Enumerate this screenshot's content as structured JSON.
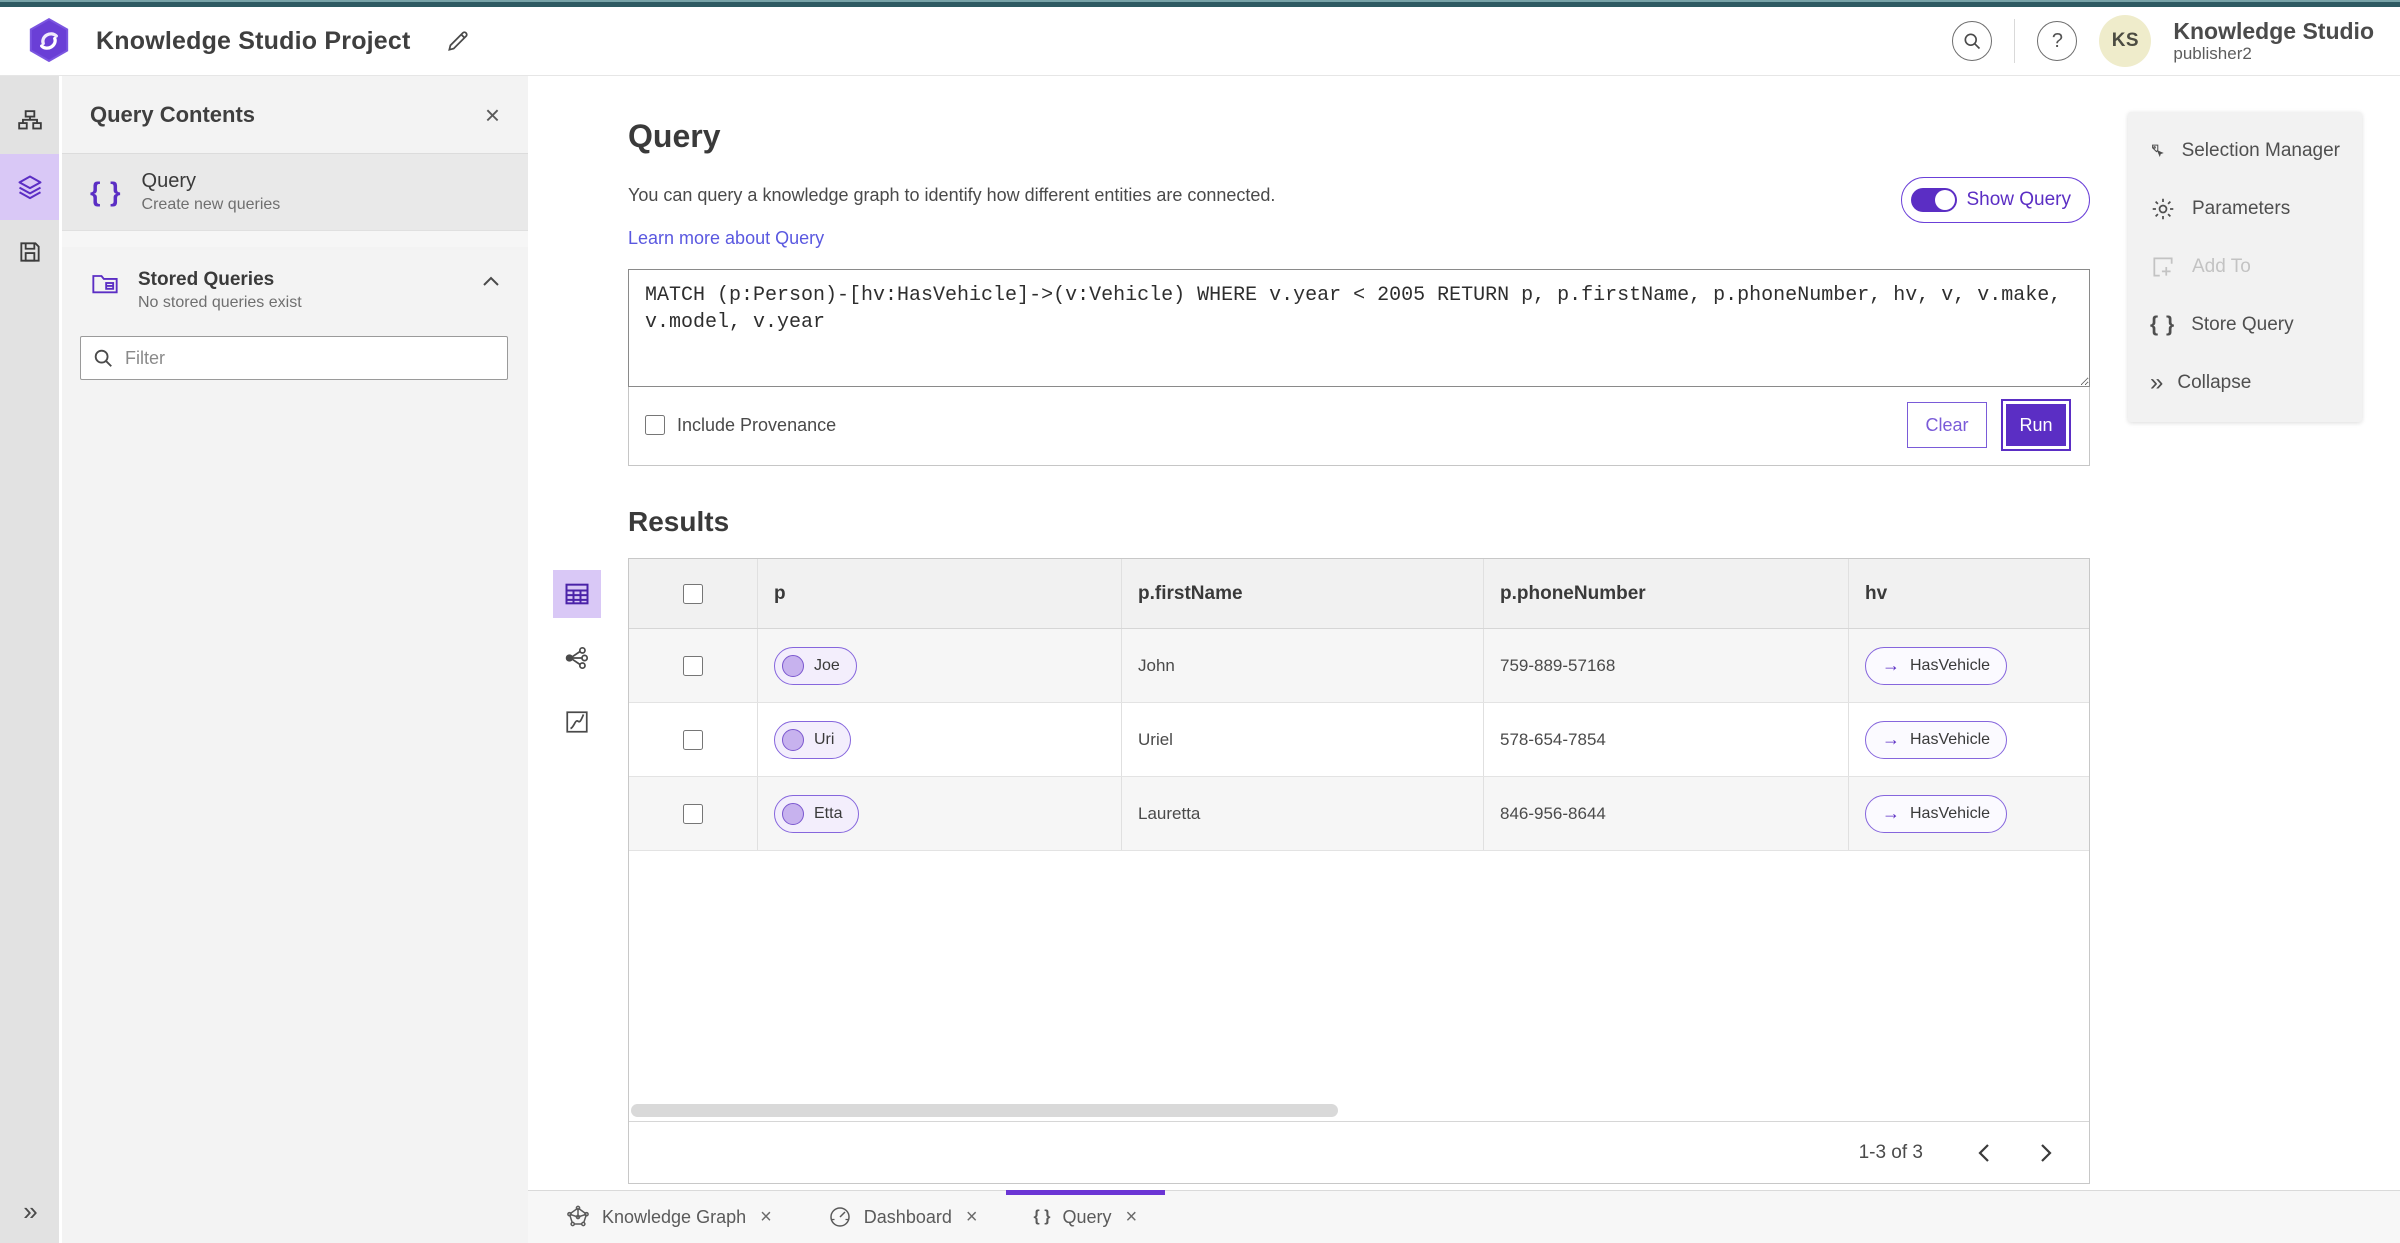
{
  "header": {
    "title": "Knowledge Studio Project",
    "user_initials": "KS",
    "user_name": "Knowledge Studio",
    "user_role": "publisher2"
  },
  "glyphs": {
    "close": "×",
    "braces": "{ }",
    "help": "?",
    "collapse": "»",
    "expand": "»",
    "arrow": "→"
  },
  "sidebar": {
    "title": "Query Contents",
    "query_item": {
      "label": "Query",
      "description": "Create new queries"
    },
    "stored": {
      "label": "Stored Queries",
      "description": "No stored queries exist"
    },
    "filter_placeholder": "Filter"
  },
  "query": {
    "heading": "Query",
    "description": "You can query a knowledge graph to identify how different entities are connected.",
    "link": "Learn more about Query",
    "show_query_label": "Show Query",
    "text": "MATCH (p:Person)-[hv:HasVehicle]->(v:Vehicle) WHERE v.year < 2005 RETURN p, p.firstName, p.phoneNumber, hv, v, v.make, v.model, v.year",
    "include_provenance_label": "Include Provenance",
    "clear_label": "Clear",
    "run_label": "Run"
  },
  "results": {
    "heading": "Results",
    "columns": {
      "0": "p",
      "1": "p.firstName",
      "2": "p.phoneNumber",
      "3": "hv"
    },
    "rows": [
      {
        "p": "Joe",
        "firstName": "John",
        "phoneNumber": "759-889-57168",
        "hv": "HasVehicle"
      },
      {
        "p": "Uri",
        "firstName": "Uriel",
        "phoneNumber": "578-654-7854",
        "hv": "HasVehicle"
      },
      {
        "p": "Etta",
        "firstName": "Lauretta",
        "phoneNumber": "846-956-8644",
        "hv": "HasVehicle"
      }
    ],
    "pagination": "1-3 of 3"
  },
  "right_panel": {
    "selection_manager": "Selection Manager",
    "parameters": "Parameters",
    "add_to": "Add To",
    "store_query": "Store Query",
    "collapse": "Collapse"
  },
  "tabs": {
    "knowledge_graph": "Knowledge Graph",
    "dashboard": "Dashboard",
    "query": "Query"
  },
  "colors": {
    "accent": "#5b2ec4",
    "accent_light": "#d9c8f6",
    "link": "#5a58e0",
    "top_accent": "#2e5a62",
    "avatar_bg": "#efeccb"
  }
}
